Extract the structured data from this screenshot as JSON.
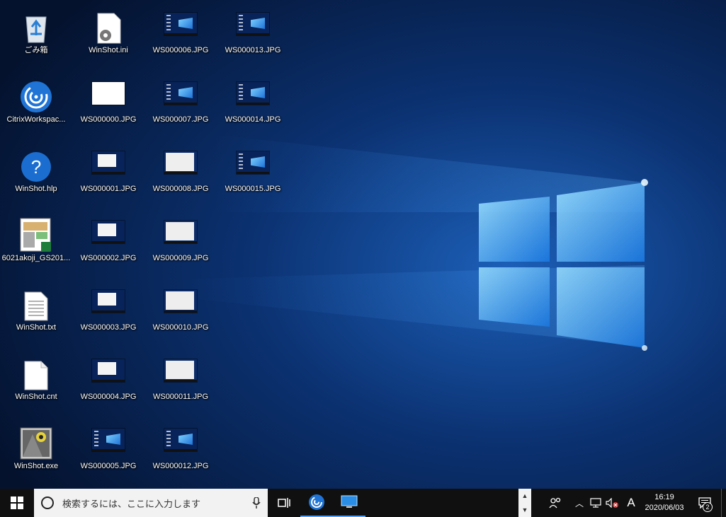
{
  "desktop": {
    "columns": [
      [
        {
          "label": "ごみ箱",
          "icon": "recycle-bin-icon",
          "kind": "recycle"
        },
        {
          "label": "CitrixWorkspac...",
          "icon": "citrix-workspace-icon",
          "kind": "citrix"
        },
        {
          "label": "WinShot.hlp",
          "icon": "help-file-icon",
          "kind": "help"
        },
        {
          "label": "6021akoji_GS201...",
          "icon": "spreadsheet-file-icon",
          "kind": "sheet"
        },
        {
          "label": "WinShot.txt",
          "icon": "text-file-icon",
          "kind": "txt"
        },
        {
          "label": "WinShot.cnt",
          "icon": "blank-file-icon",
          "kind": "blank"
        },
        {
          "label": "WinShot.exe",
          "icon": "winshot-app-icon",
          "kind": "exe"
        }
      ],
      [
        {
          "label": "WinShot.ini",
          "icon": "settings-file-icon",
          "kind": "ini"
        },
        {
          "label": "WS000000.JPG",
          "icon": "jpg-thumbnail-icon",
          "kind": "white"
        },
        {
          "label": "WS000001.JPG",
          "icon": "jpg-thumbnail-icon",
          "kind": "win"
        },
        {
          "label": "WS000002.JPG",
          "icon": "jpg-thumbnail-icon",
          "kind": "win"
        },
        {
          "label": "WS000003.JPG",
          "icon": "jpg-thumbnail-icon",
          "kind": "win"
        },
        {
          "label": "WS000004.JPG",
          "icon": "jpg-thumbnail-icon",
          "kind": "win"
        },
        {
          "label": "WS000005.JPG",
          "icon": "jpg-thumbnail-icon",
          "kind": "desk"
        }
      ],
      [
        {
          "label": "WS000006.JPG",
          "icon": "jpg-thumbnail-icon",
          "kind": "desk"
        },
        {
          "label": "WS000007.JPG",
          "icon": "jpg-thumbnail-icon",
          "kind": "desk"
        },
        {
          "label": "WS000008.JPG",
          "icon": "jpg-thumbnail-icon",
          "kind": "whitewin"
        },
        {
          "label": "WS000009.JPG",
          "icon": "jpg-thumbnail-icon",
          "kind": "whitewin"
        },
        {
          "label": "WS000010.JPG",
          "icon": "jpg-thumbnail-icon",
          "kind": "whitewin"
        },
        {
          "label": "WS000011.JPG",
          "icon": "jpg-thumbnail-icon",
          "kind": "whitewin"
        },
        {
          "label": "WS000012.JPG",
          "icon": "jpg-thumbnail-icon",
          "kind": "desk"
        }
      ],
      [
        {
          "label": "WS000013.JPG",
          "icon": "jpg-thumbnail-icon",
          "kind": "desk"
        },
        {
          "label": "WS000014.JPG",
          "icon": "jpg-thumbnail-icon",
          "kind": "desk"
        },
        {
          "label": "WS000015.JPG",
          "icon": "jpg-thumbnail-icon",
          "kind": "desk"
        }
      ]
    ]
  },
  "taskbar": {
    "search_placeholder": "検索するには、ここに入力します",
    "ime_indicator": "A",
    "time": "16:19",
    "date": "2020/06/03",
    "notification_count": "2",
    "colors": {
      "background": "#101010",
      "accent": "#4fa3ff"
    }
  }
}
